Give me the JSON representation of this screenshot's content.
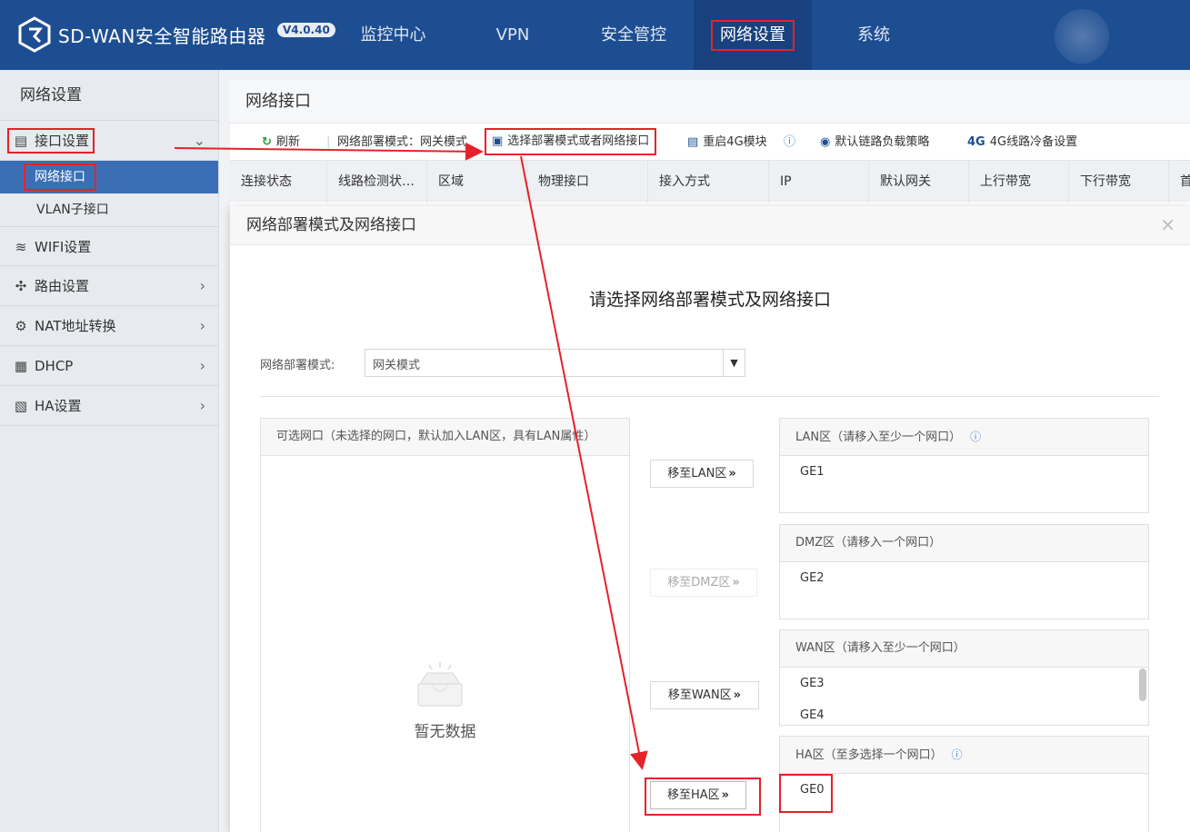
{
  "header": {
    "brand": "SD-WAN安全智能路由器",
    "version": "V4.0.40",
    "nav": [
      "监控中心",
      "VPN",
      "安全管控",
      "网络设置",
      "系统"
    ]
  },
  "sidebar": {
    "title": "网络设置",
    "items": [
      {
        "label": "接口设置",
        "icon": "interface-icon"
      },
      {
        "label": "WIFI设置",
        "icon": "wifi-icon"
      },
      {
        "label": "路由设置",
        "icon": "route-icon"
      },
      {
        "label": "NAT地址转换",
        "icon": "gear-icon"
      },
      {
        "label": "DHCP",
        "icon": "dhcp-icon"
      },
      {
        "label": "HA设置",
        "icon": "ha-icon"
      }
    ],
    "subitems": [
      "网络接口",
      "VLAN子接口"
    ]
  },
  "main": {
    "title": "网络接口",
    "toolbar": {
      "refresh": "刷新",
      "mode_text": "网络部署模式：网关模式",
      "select_mode": "选择部署模式或者网络接口",
      "restart_4g": "重启4G模块",
      "default_lb": "默认链路负载策略",
      "backup_4g": "4G线路冷备设置"
    },
    "columns": [
      "连接状态",
      "线路检测状…",
      "区域",
      "物理接口",
      "接入方式",
      "IP",
      "默认网关",
      "上行带宽",
      "下行带宽",
      "首"
    ]
  },
  "modal": {
    "title": "网络部署模式及网络接口",
    "close": "×",
    "subtitle": "请选择网络部署模式及网络接口",
    "mode_label": "网络部署模式:",
    "mode_value": "网关模式",
    "available_header": "可选网口（未选择的网口，默认加入LAN区，具有LAN属性）",
    "empty_text": "暂无数据",
    "buttons": {
      "to_lan": "移至LAN区",
      "to_dmz": "移至DMZ区",
      "to_wan": "移至WAN区",
      "to_ha": "移至HA区"
    },
    "zones": {
      "lan": {
        "header": "LAN区（请移入至少一个网口）",
        "items": [
          "GE1"
        ]
      },
      "dmz": {
        "header": "DMZ区（请移入一个网口）",
        "items": [
          "GE2"
        ]
      },
      "wan": {
        "header": "WAN区（请移入至少一个网口）",
        "items": [
          "GE3",
          "GE4"
        ]
      },
      "ha": {
        "header": "HA区（至多选择一个网口）",
        "items": [
          "GE0"
        ]
      }
    }
  },
  "colors": {
    "header_bg": "#1e4e92",
    "sidebar_bg": "#e7eaef",
    "active_blue": "#3a6fb5",
    "annotation_red": "#e6212a"
  }
}
